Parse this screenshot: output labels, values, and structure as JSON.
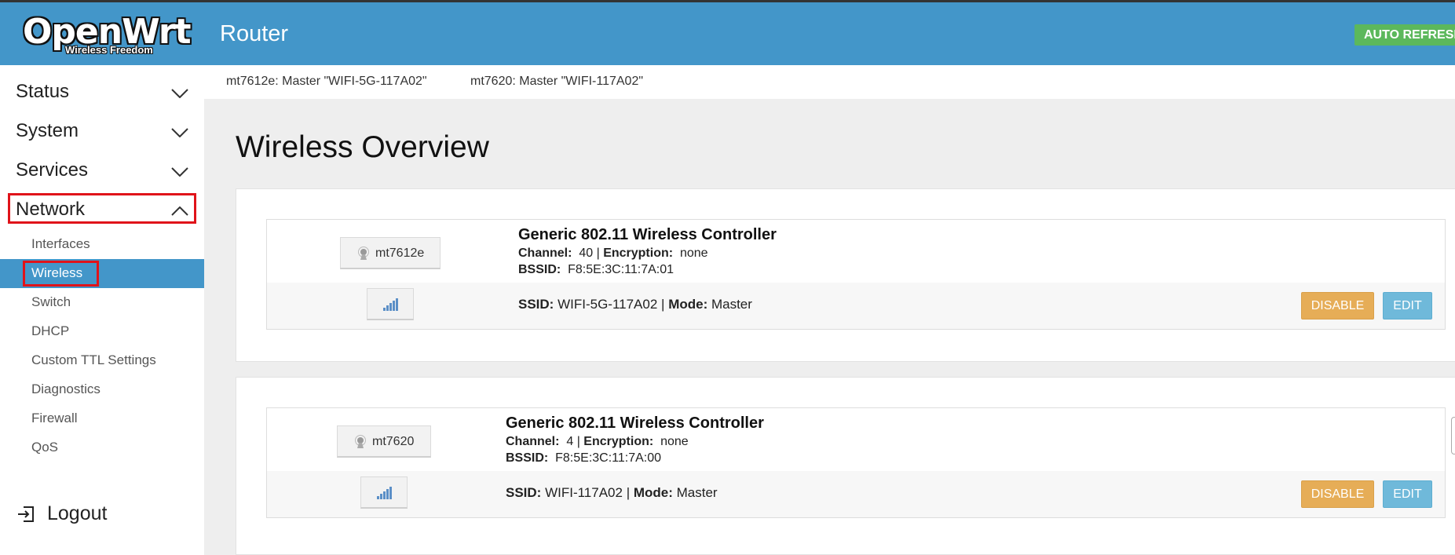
{
  "header": {
    "logo_text": "OpenWrt",
    "logo_tagline": "Wireless Freedom",
    "hostname": "Router",
    "auto_refresh_label": "AUTO REFRESH"
  },
  "sidebar": {
    "menus": [
      {
        "label": "Status",
        "expanded": false
      },
      {
        "label": "System",
        "expanded": false
      },
      {
        "label": "Services",
        "expanded": false
      },
      {
        "label": "Network",
        "expanded": true
      }
    ],
    "network_items": [
      {
        "label": "Interfaces",
        "active": false
      },
      {
        "label": "Wireless",
        "active": true
      },
      {
        "label": "Switch",
        "active": false
      },
      {
        "label": "DHCP",
        "active": false
      },
      {
        "label": "Custom TTL Settings",
        "active": false
      },
      {
        "label": "Diagnostics",
        "active": false
      },
      {
        "label": "Firewall",
        "active": false
      },
      {
        "label": "QoS",
        "active": false
      }
    ],
    "logout_label": "Logout"
  },
  "tabs": [
    {
      "label": "mt7612e: Master \"WIFI-5G-117A02\""
    },
    {
      "label": "mt7620: Master \"WIFI-117A02\""
    }
  ],
  "page": {
    "title": "Wireless Overview"
  },
  "devices": [
    {
      "name": "mt7612e",
      "controller": "Generic 802.11 Wireless Controller",
      "channel_label": "Channel:",
      "channel": "40",
      "encryption_label": "Encryption:",
      "encryption": "none",
      "bssid_label": "BSSID:",
      "bssid": "F8:5E:3C:11:7A:01",
      "ssid_label": "SSID:",
      "ssid": "WIFI-5G-117A02",
      "mode_label": "Mode:",
      "mode": "Master",
      "disable_label": "DISABLE",
      "edit_label": "EDIT"
    },
    {
      "name": "mt7620",
      "controller": "Generic 802.11 Wireless Controller",
      "channel_label": "Channel:",
      "channel": "4",
      "encryption_label": "Encryption:",
      "encryption": "none",
      "bssid_label": "BSSID:",
      "bssid": "F8:5E:3C:11:7A:00",
      "ssid_label": "SSID:",
      "ssid": "WIFI-117A02",
      "mode_label": "Mode:",
      "mode": "Master",
      "disable_label": "DISABLE",
      "edit_label": "EDIT"
    }
  ],
  "colors": {
    "header_bg": "#4396c9",
    "active_item_bg": "#4396c9",
    "highlight_box": "#e0131a",
    "disable_btn": "#e6ad57",
    "edit_btn": "#6fb9da",
    "auto_refresh": "#5cb85c"
  }
}
